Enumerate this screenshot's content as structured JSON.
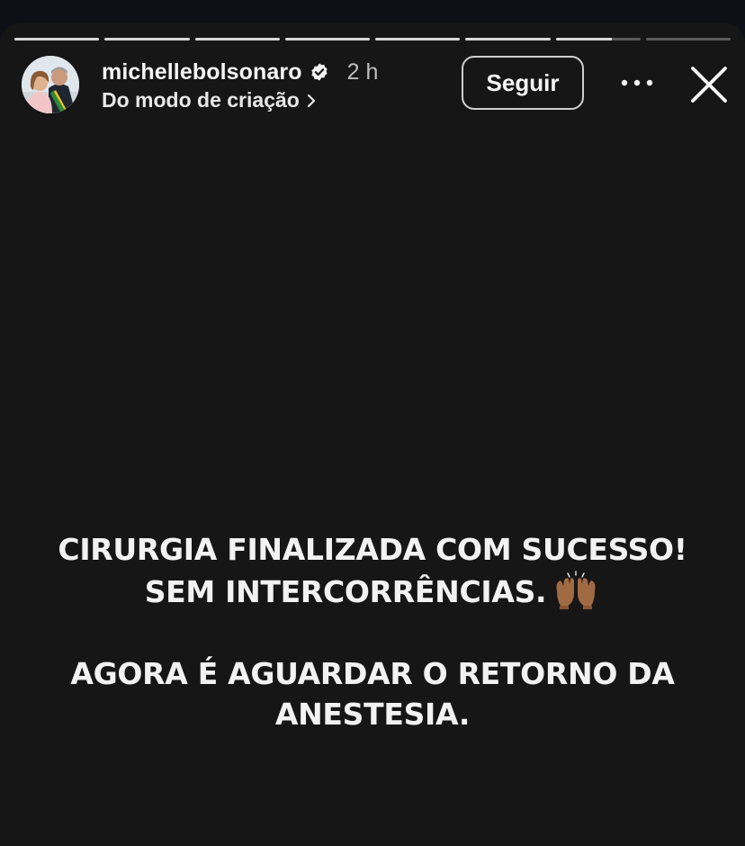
{
  "story": {
    "segments": [
      {
        "progress": 1.0
      },
      {
        "progress": 1.0
      },
      {
        "progress": 1.0
      },
      {
        "progress": 1.0
      },
      {
        "progress": 1.0
      },
      {
        "progress": 1.0
      },
      {
        "progress": 0.66
      },
      {
        "progress": 0.0
      }
    ]
  },
  "header": {
    "username": "michellebolsonaro",
    "time": "2 h",
    "subtitle": "Do modo de criação",
    "follow_label": "Seguir"
  },
  "content": {
    "line1": "CIRURGIA FINALIZADA COM SUCESSO!",
    "line2": "SEM INTERCORRÊNCIAS.",
    "line3": "AGORA É AGUARDAR O RETORNO DA",
    "line4": "ANESTESIA."
  },
  "icons": {
    "verified": "verified-badge-icon",
    "chevron": "chevron-right-icon",
    "more": "more-dots-icon",
    "close": "close-icon",
    "emoji": "raising-hands-emoji"
  },
  "colors": {
    "background": "#161616",
    "text": "#f2f2f2",
    "progress_fill": "#d9d9d9",
    "progress_track": "#5b5b5b"
  }
}
